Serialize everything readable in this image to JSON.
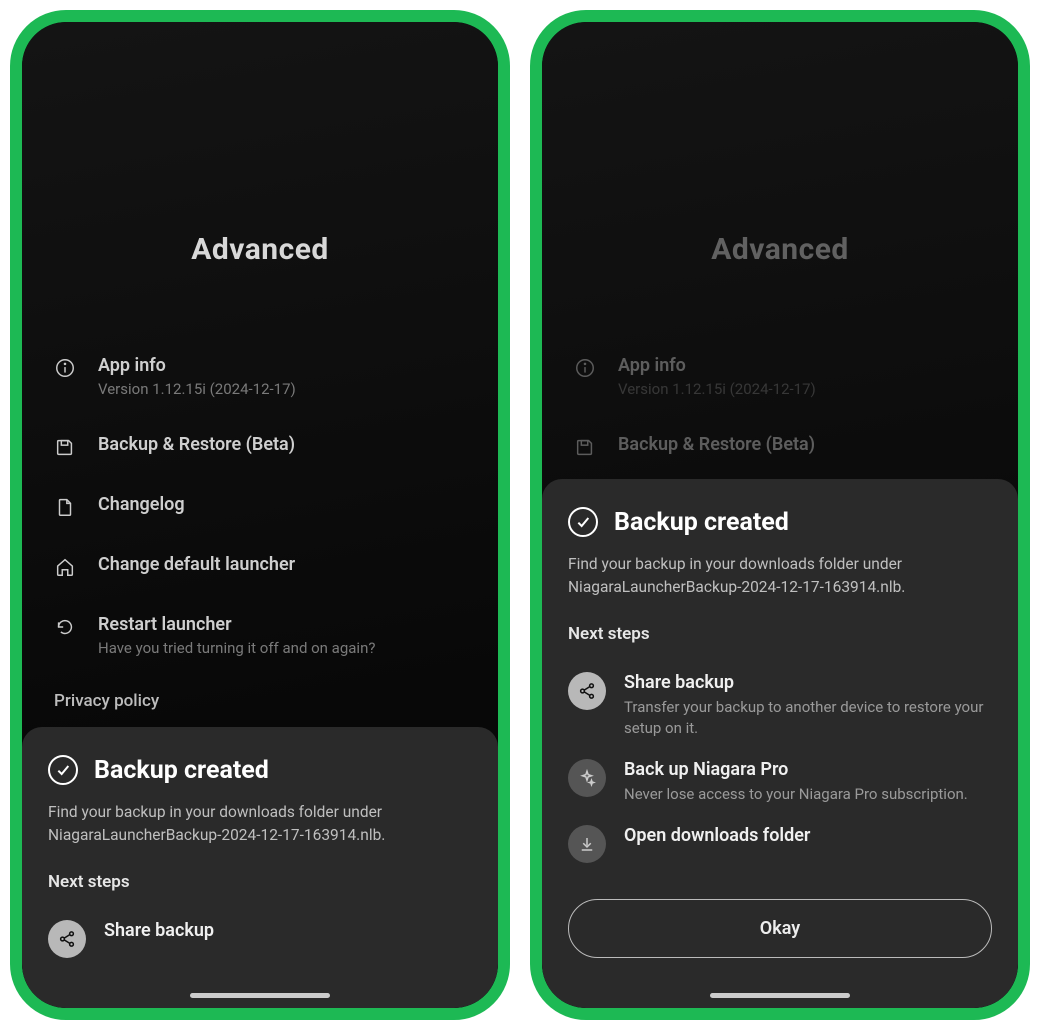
{
  "page_title": "Advanced",
  "menu": {
    "app_info": {
      "label": "App info",
      "sub": "Version 1.12.15i (2024-12-17)"
    },
    "backup_restore": {
      "label": "Backup & Restore (Beta)"
    },
    "changelog": {
      "label": "Changelog"
    },
    "default_launcher": {
      "label": "Change default launcher"
    },
    "restart": {
      "label": "Restart launcher",
      "sub": "Have you tried turning it off and on again?"
    }
  },
  "privacy_label": "Privacy policy",
  "sheet": {
    "title": "Backup created",
    "desc": "Find your backup in your downloads folder under NiagaraLauncherBackup-2024-12-17-163914.nlb.",
    "next_steps_label": "Next steps",
    "steps": {
      "share": {
        "title": "Share backup",
        "sub": "Transfer your backup to another device to restore your setup on it."
      },
      "pro": {
        "title": "Back up Niagara Pro",
        "sub": "Never lose access to your Niagara Pro subscription."
      },
      "open": {
        "title": "Open downloads folder"
      }
    },
    "okay_label": "Okay"
  }
}
